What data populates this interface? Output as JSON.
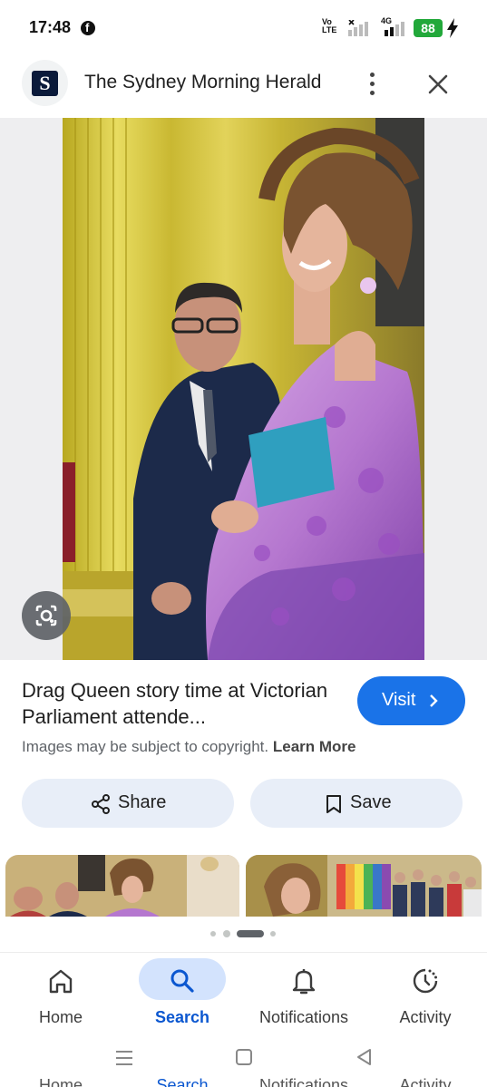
{
  "status_bar": {
    "time": "17:48",
    "volte": "Vo LTE",
    "network": "4G",
    "battery": "88"
  },
  "header": {
    "site_name": "The Sydney Morning Herald",
    "logo_letter": "S"
  },
  "result": {
    "title": "Drag Queen story time at Victorian Parliament attende...",
    "visit_label": "Visit",
    "copyright_text": "Images may be subject to copyright.",
    "learn_more": "Learn More"
  },
  "actions": {
    "share_label": "Share",
    "save_label": "Save"
  },
  "bottom_nav": {
    "items": [
      {
        "label": "Home",
        "icon": "home-icon",
        "active": false
      },
      {
        "label": "Search",
        "icon": "search-icon",
        "active": true
      },
      {
        "label": "Notifications",
        "icon": "bell-icon",
        "active": false
      },
      {
        "label": "Activity",
        "icon": "activity-icon",
        "active": false
      }
    ]
  },
  "colors": {
    "accent": "#1a73e8",
    "active_nav": "#0b57d0",
    "pill_bg": "#e8eef8",
    "battery": "#22a83a"
  }
}
